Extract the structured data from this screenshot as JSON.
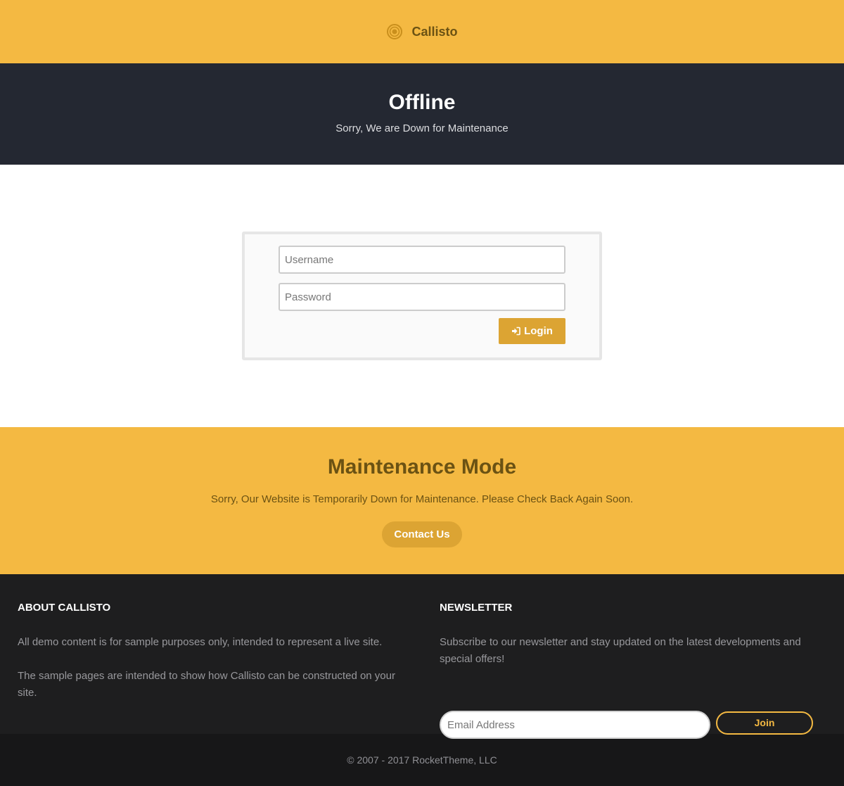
{
  "header": {
    "brand": "Callisto",
    "logo_icon": "target-circle-icon"
  },
  "hero": {
    "title": "Offline",
    "subtitle": "Sorry, We are Down for Maintenance"
  },
  "login": {
    "username_placeholder": "Username",
    "password_placeholder": "Password",
    "button_label": "Login",
    "button_icon": "sign-in-icon"
  },
  "maintenance": {
    "title": "Maintenance Mode",
    "text": "Sorry, Our Website is Temporarily Down for Maintenance. Please Check Back Again Soon.",
    "contact_label": "Contact Us"
  },
  "footer": {
    "about": {
      "title": "ABOUT CALLISTO",
      "paragraphs": [
        "All demo content is for sample purposes only, intended to represent a live site.",
        "The sample pages are intended to show how Callisto can be constructed on your site."
      ]
    },
    "newsletter": {
      "title": "NEWSLETTER",
      "text": "Subscribe to our newsletter and stay updated on the latest developments and special offers!",
      "email_placeholder": "Email Address",
      "join_label": "Join"
    },
    "copyright": "© 2007 - 2017 RocketTheme, LLC"
  },
  "colors": {
    "accent": "#f4b942",
    "accent_dark": "#dca433",
    "brand_text": "#6b5213",
    "hero_bg": "#242832",
    "footer_bg": "#1e1e1f",
    "copyright_bg": "#171718"
  }
}
